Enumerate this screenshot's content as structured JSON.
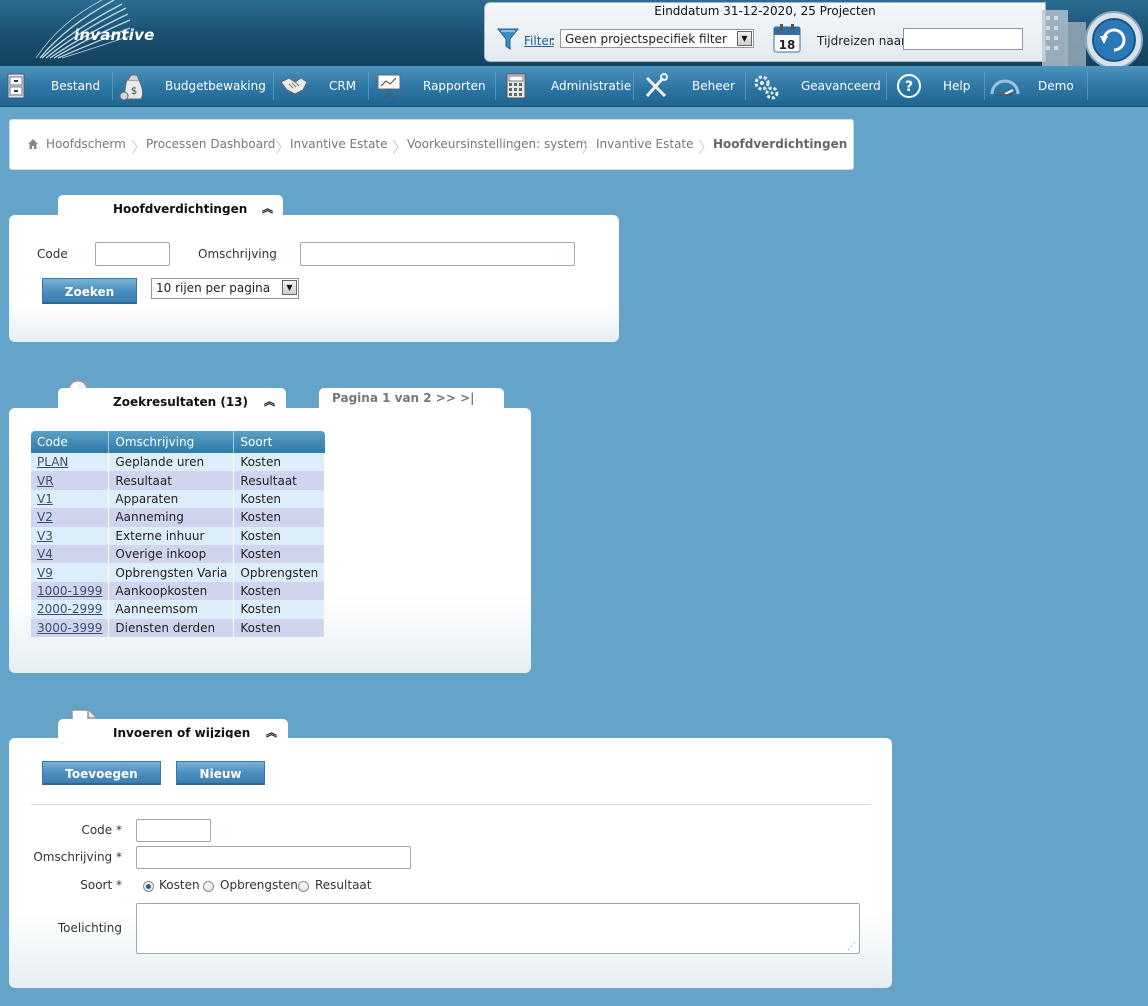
{
  "header": {
    "logo_text": "invantive",
    "filter_title": "Einddatum 31-12-2020, 25 Projecten",
    "filter_link": "Filter",
    "filter_colon": ":",
    "filter_select_value": "Geen projectspecifiek filter",
    "calendar_day": "18",
    "tijdreizen_label": "Tijdreizen naar:",
    "tijdreizen_value": ""
  },
  "nav": {
    "items": [
      {
        "label": "Bestand",
        "icon": "file-cabinet-icon"
      },
      {
        "label": "Budgetbewaking",
        "icon": "money-bag-icon"
      },
      {
        "label": "CRM",
        "icon": "handshake-icon"
      },
      {
        "label": "Rapporten",
        "icon": "presentation-icon"
      },
      {
        "label": "Administratie",
        "icon": "calculator-icon"
      },
      {
        "label": "Beheer",
        "icon": "tools-icon"
      },
      {
        "label": "Geavanceerd",
        "icon": "gears-icon"
      },
      {
        "label": "Help",
        "icon": "help-icon"
      },
      {
        "label": "Demo",
        "icon": "gauge-icon"
      }
    ]
  },
  "breadcrumb": {
    "items": [
      "Hoofdscherm",
      "Processen Dashboard",
      "Invantive Estate",
      "Voorkeursinstellingen: system",
      "Invantive Estate",
      "Hoofdverdichtingen"
    ]
  },
  "search_panel": {
    "title": "Hoofdverdichtingen",
    "code_label": "Code",
    "code_value": "",
    "omschrijving_label": "Omschrijving",
    "omschrijving_value": "",
    "search_button": "Zoeken",
    "rows_select": "10 rijen per pagina"
  },
  "results_panel": {
    "title": "Zoekresultaten (13)",
    "pager": "Pagina 1 van 2 >> >|",
    "columns": [
      "Code",
      "Omschrijving",
      "Soort"
    ],
    "rows": [
      [
        "PLAN",
        "Geplande uren",
        "Kosten"
      ],
      [
        "VR",
        "Resultaat",
        "Resultaat"
      ],
      [
        "V1",
        "Apparaten",
        "Kosten"
      ],
      [
        "V2",
        "Aanneming",
        "Kosten"
      ],
      [
        "V3",
        "Externe inhuur",
        "Kosten"
      ],
      [
        "V4",
        "Overige inkoop",
        "Kosten"
      ],
      [
        "V9",
        "Opbrengsten Varia",
        "Opbrengsten"
      ],
      [
        "1000-1999",
        "Aankoopkosten",
        "Kosten"
      ],
      [
        "2000-2999",
        "Aanneemsom",
        "Kosten"
      ],
      [
        "3000-3999",
        "Diensten derden",
        "Kosten"
      ]
    ]
  },
  "edit_panel": {
    "title": "Invoeren of wijzigen",
    "add_button": "Toevoegen",
    "new_button": "Nieuw",
    "code_label": "Code *",
    "code_value": "",
    "omschrijving_label": "Omschrijving *",
    "omschrijving_value": "",
    "soort_label": "Soort *",
    "soort_options": [
      "Kosten",
      "Opbrengsten",
      "Resultaat"
    ],
    "soort_selected": "Kosten",
    "toelichting_label": "Toelichting",
    "toelichting_value": ""
  },
  "colors": {
    "page_background": "#63a4c8",
    "header_dark": "#1a4f70",
    "nav_blue": "#2f78a6",
    "button_blue": "#4d8fbf",
    "row_light": "#ddeefb",
    "row_lavender": "#cfd4ef"
  }
}
